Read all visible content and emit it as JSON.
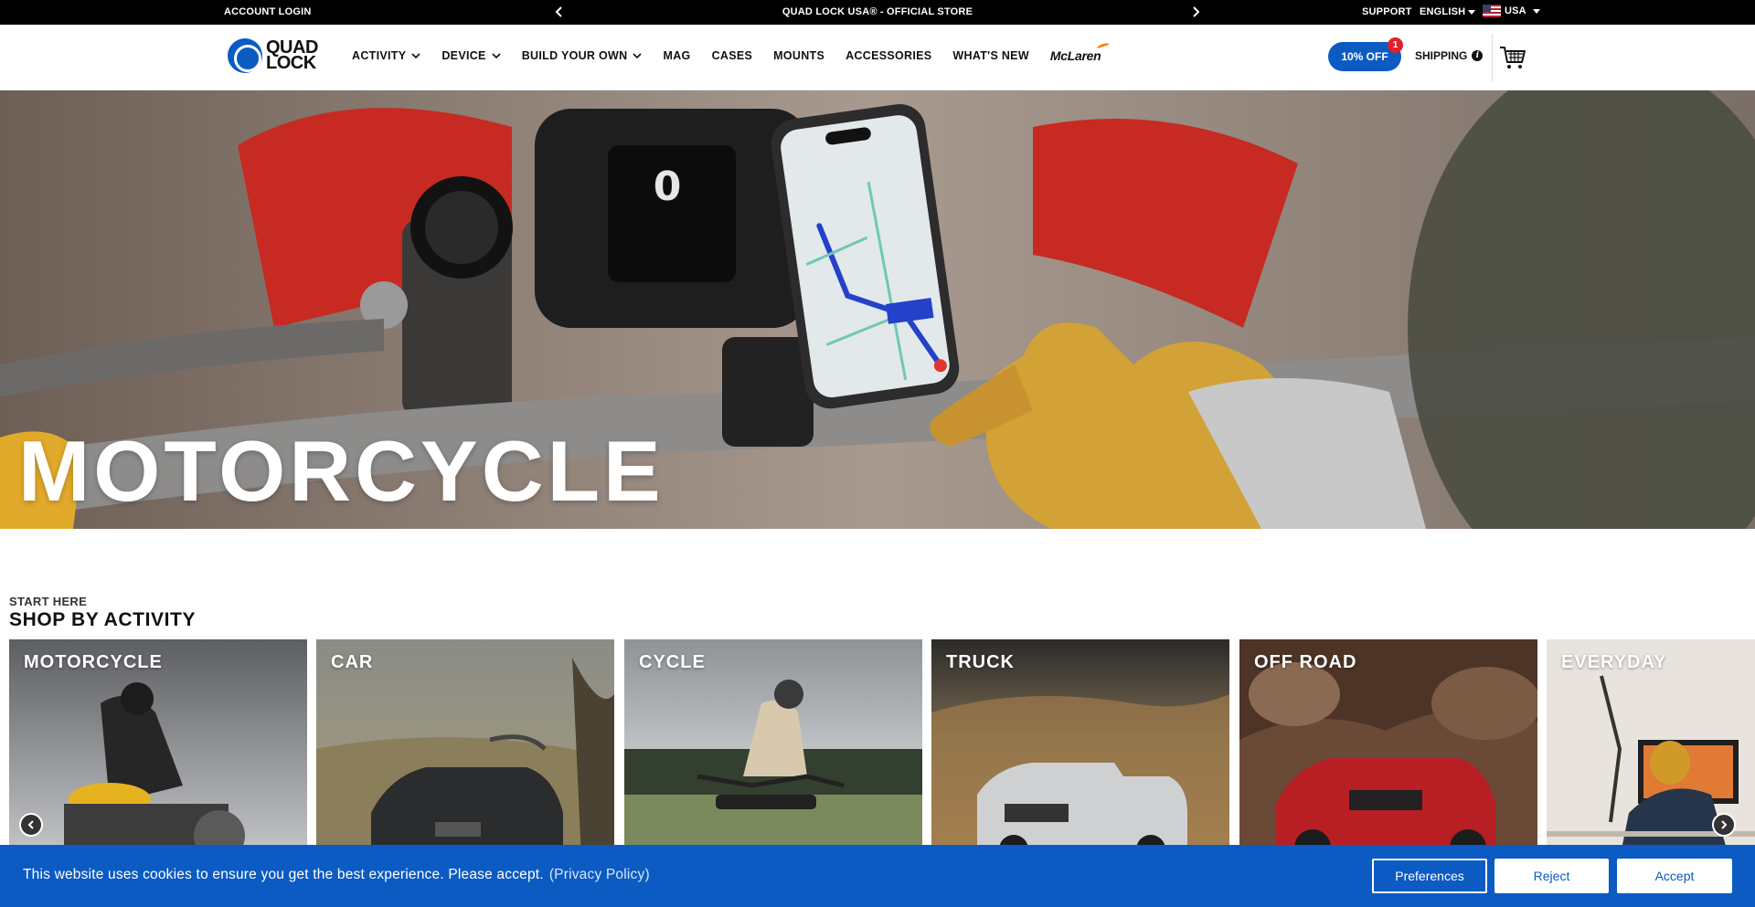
{
  "topbar": {
    "account_login": "ACCOUNT LOGIN",
    "promo": "QUAD LOCK USA® - OFFICIAL STORE",
    "support": "SUPPORT",
    "language": "ENGLISH",
    "country": "USA"
  },
  "header": {
    "logo_line1": "QUAD",
    "logo_line2": "LOCK",
    "nav": [
      {
        "label": "ACTIVITY",
        "has_dropdown": true
      },
      {
        "label": "DEVICE",
        "has_dropdown": true
      },
      {
        "label": "BUILD YOUR OWN",
        "has_dropdown": true
      },
      {
        "label": "MAG",
        "has_dropdown": false
      },
      {
        "label": "CASES",
        "has_dropdown": false
      },
      {
        "label": "MOUNTS",
        "has_dropdown": false
      },
      {
        "label": "ACCESSORIES",
        "has_dropdown": false
      },
      {
        "label": "WHAT'S NEW",
        "has_dropdown": false
      }
    ],
    "partner_logo": "McLaren",
    "discount_label": "10% OFF",
    "discount_badge": "1",
    "shipping_label": "SHIPPING"
  },
  "hero": {
    "title": "MOTORCYCLE"
  },
  "activity": {
    "eyebrow": "START HERE",
    "title": "SHOP BY ACTIVITY",
    "cards": [
      {
        "label": "MOTORCYCLE"
      },
      {
        "label": "CAR"
      },
      {
        "label": "CYCLE"
      },
      {
        "label": "TRUCK"
      },
      {
        "label": "OFF ROAD"
      },
      {
        "label": "EVERYDAY"
      }
    ]
  },
  "cookie": {
    "message": "This website uses cookies to ensure you get the best experience. Please accept.",
    "policy_link": "(Privacy Policy)",
    "preferences": "Preferences",
    "reject": "Reject",
    "accept": "Accept"
  },
  "colors": {
    "brand_blue": "#0b5bc2",
    "badge_red": "#e0202a",
    "mclaren_orange": "#ff8000"
  },
  "icons": [
    "chevron-left-icon",
    "chevron-right-icon",
    "chevron-down-icon",
    "info-icon",
    "cart-icon",
    "us-flag-icon"
  ]
}
